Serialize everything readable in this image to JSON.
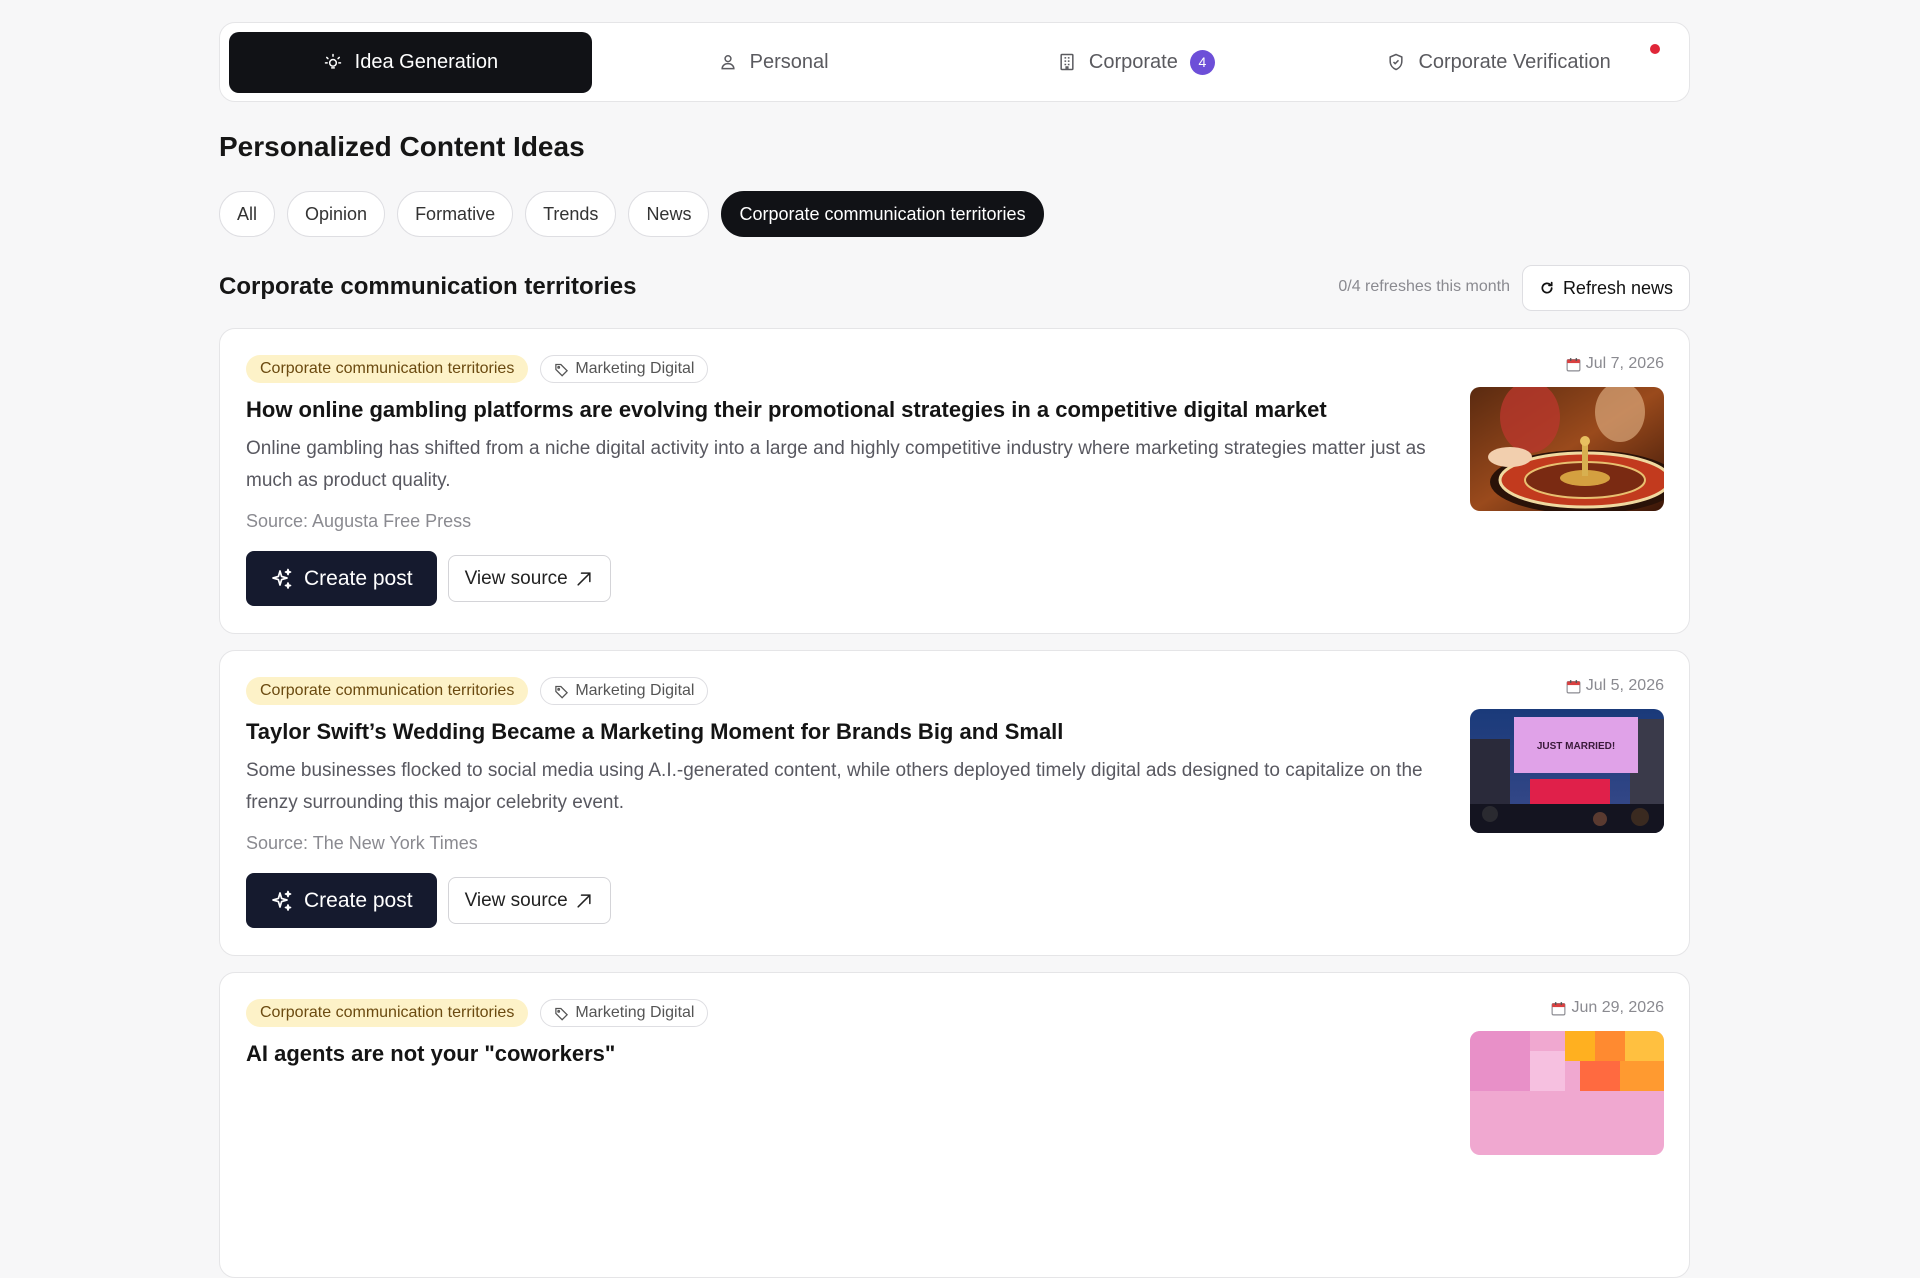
{
  "nav": {
    "tabs": [
      {
        "label": "Idea Generation"
      },
      {
        "label": "Personal"
      },
      {
        "label": "Corporate",
        "badge": "4"
      },
      {
        "label": "Corporate Verification"
      }
    ]
  },
  "page_title": "Personalized Content Ideas",
  "filters": [
    "All",
    "Opinion",
    "Formative",
    "Trends",
    "News",
    "Corporate communication territories"
  ],
  "section": {
    "title": "Corporate communication territories",
    "refresh_info": "0/4 refreshes this month",
    "refresh_label": "Refresh news"
  },
  "cards": [
    {
      "category": "Corporate communication territories",
      "topic": "Marketing Digital",
      "date": "Jul 7, 2026",
      "title": "How online gambling platforms are evolving their promotional strategies in a competitive digital market",
      "desc": "Online gambling has shifted from a niche digital activity into a large and highly competitive industry where marketing strategies matter just as much as product quality.",
      "source": "Source: Augusta Free Press",
      "create_label": "Create post",
      "view_label": "View source"
    },
    {
      "category": "Corporate communication territories",
      "topic": "Marketing Digital",
      "date": "Jul 5, 2026",
      "title": "Taylor Swift’s Wedding Became a Marketing Moment for Brands Big and Small",
      "desc": "Some businesses flocked to social media using A.I.-generated content, while others deployed timely digital ads designed to capitalize on the frenzy surrounding this major celebrity event.",
      "source": "Source: The New York Times",
      "create_label": "Create post",
      "view_label": "View source",
      "thumb_text": "JUST MARRIED!"
    },
    {
      "category": "Corporate communication territories",
      "topic": "Marketing Digital",
      "date": "Jun 29, 2026",
      "title": "AI agents are not your \"coworkers\""
    }
  ],
  "colors": {
    "accent_dark": "#111216",
    "badge": "#6d4fd8",
    "category_bg": "#fdf2c8",
    "notification": "#e02638"
  }
}
